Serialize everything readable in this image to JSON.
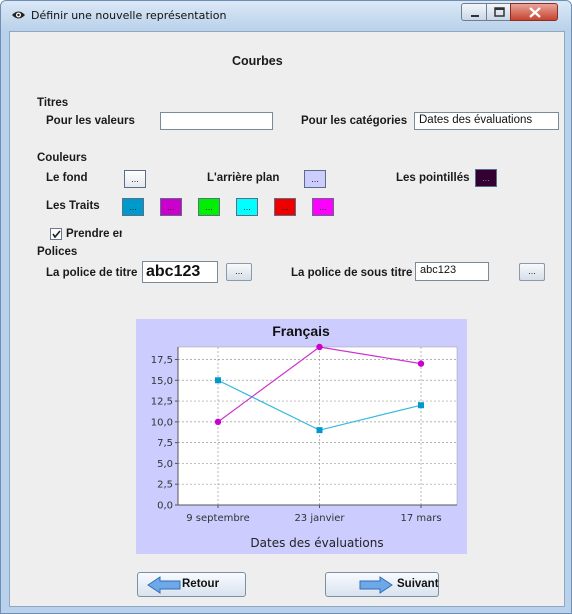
{
  "window": {
    "title": "Définir une nouvelle représentation"
  },
  "heading": "Courbes",
  "titres": {
    "section": "Titres",
    "values_label": "Pour les valeurs",
    "values_value": "",
    "categories_label": "Pour les catégories",
    "categories_value": "Dates des évaluations"
  },
  "couleurs": {
    "section": "Couleurs",
    "fond_label": "Le fond",
    "arriere_label": "L'arrière plan",
    "pointilles_label": "Les pointillés",
    "traits_label": "Les Traits",
    "button_text": "...",
    "fond_color": "#ffffff",
    "arriere_color": "#ccccff",
    "pointilles_color": "#330033",
    "traits_colors": [
      "#0099cc",
      "#cc00cc",
      "#00ee00",
      "#00ffff",
      "#ee0000",
      "#ff00ff"
    ]
  },
  "prendre": {
    "label": "Prendre en",
    "checked": true
  },
  "polices": {
    "section": "Polices",
    "titre_label": "La police de titre",
    "titre_sample": "abc123",
    "soustitre_label": "La police de sous titre",
    "soustitre_sample": "abc123",
    "button_text": "..."
  },
  "chart_data": {
    "type": "line",
    "title": "Français",
    "xlabel": "Dates des évaluations",
    "ylabel": "",
    "categories": [
      "9 septembre",
      "23 janvier",
      "17 mars"
    ],
    "ylim": [
      0,
      19
    ],
    "yticks": [
      "0,0",
      "2,5",
      "5,0",
      "7,5",
      "10,0",
      "12,5",
      "15,0",
      "17,5"
    ],
    "ytick_values": [
      0,
      2.5,
      5,
      7.5,
      10,
      12.5,
      15,
      17.5
    ],
    "grid": true,
    "series": [
      {
        "values": [
          15,
          9,
          12
        ],
        "color": "#33bbdd",
        "marker": "square",
        "marker_color": "#0099cc"
      },
      {
        "values": [
          10,
          19,
          17
        ],
        "color": "#cc33cc",
        "marker": "circle",
        "marker_color": "#cc00cc"
      }
    ]
  },
  "buttons": {
    "retour": "Retour",
    "suivant": "Suivant"
  }
}
